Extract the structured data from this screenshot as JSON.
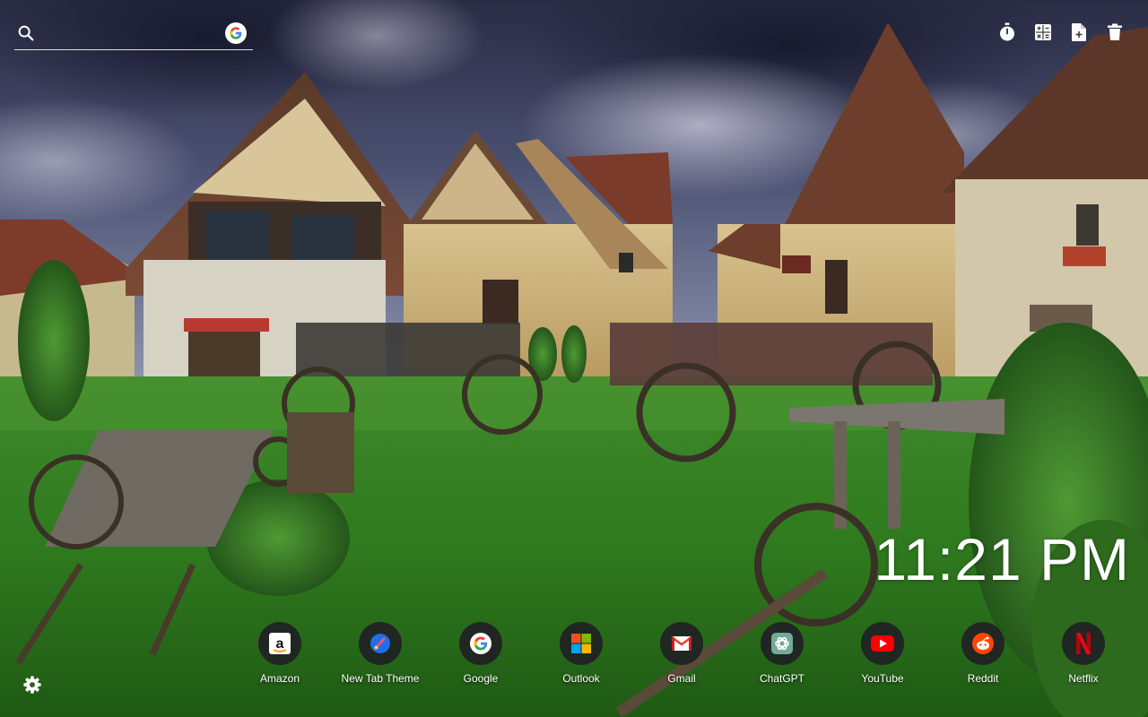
{
  "search": {
    "value": "",
    "placeholder": "",
    "icon": "search-icon",
    "engine_icon": "google-icon"
  },
  "toolbar": {
    "items": [
      {
        "name": "timer-button",
        "icon": "stopwatch-icon"
      },
      {
        "name": "calculator-button",
        "icon": "calculator-icon"
      },
      {
        "name": "add-file-button",
        "icon": "file-add-icon"
      },
      {
        "name": "delete-button",
        "icon": "trash-icon"
      }
    ]
  },
  "clock": {
    "time": "11:21 PM"
  },
  "shortcuts": [
    {
      "label": "Amazon",
      "icon": "amazon-icon",
      "color": "#ffffff"
    },
    {
      "label": "New Tab Theme",
      "icon": "new-tab-theme-icon",
      "color": "#1e6fe8"
    },
    {
      "label": "Google",
      "icon": "google-icon",
      "color": "#4285f4"
    },
    {
      "label": "Outlook",
      "icon": "microsoft-icon",
      "color": "#f25022"
    },
    {
      "label": "Gmail",
      "icon": "gmail-icon",
      "color": "#ea4335"
    },
    {
      "label": "ChatGPT",
      "icon": "chatgpt-icon",
      "color": "#74aa9c"
    },
    {
      "label": "YouTube",
      "icon": "youtube-icon",
      "color": "#ff0000"
    },
    {
      "label": "Reddit",
      "icon": "reddit-icon",
      "color": "#ff4500"
    },
    {
      "label": "Netflix",
      "icon": "netflix-icon",
      "color": "#e50914"
    }
  ],
  "settings": {
    "icon": "gear-icon"
  },
  "colors": {
    "text": "#ffffff",
    "shortcut_bg": "#202124"
  }
}
